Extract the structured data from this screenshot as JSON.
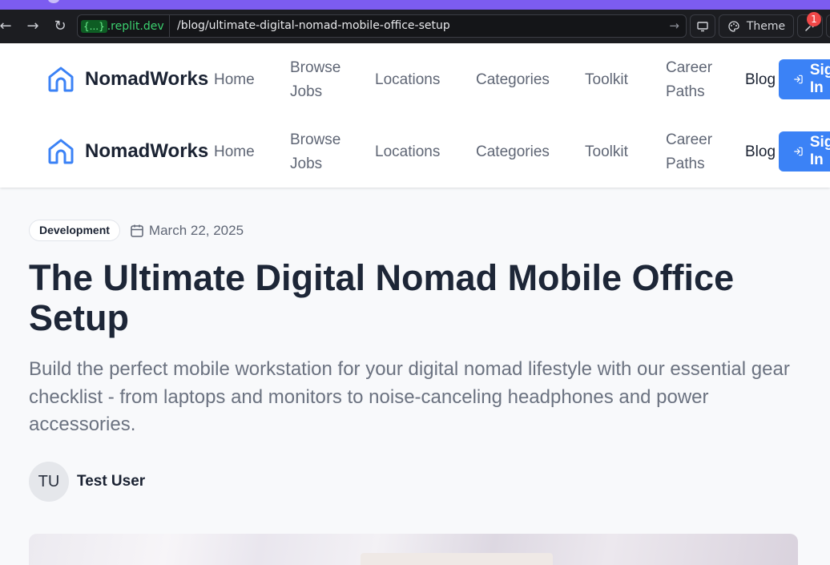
{
  "browser": {
    "host_brace": "{...}",
    "host": ".replit.dev",
    "path": "/blog/ultimate-digital-nomad-mobile-office-setup",
    "theme_label": "Theme",
    "notification_count": "1",
    "icons": [
      "back-arrow-icon",
      "forward-arrow-icon",
      "reload-icon",
      "go-arrow-icon",
      "monitor-icon",
      "palette-icon",
      "wrench-icon"
    ]
  },
  "site": {
    "brand": "NomadWorks",
    "nav": {
      "home": "Home",
      "browse_jobs_1": "Browse",
      "browse_jobs_2": "Jobs",
      "locations": "Locations",
      "categories": "Categories",
      "toolkit": "Toolkit",
      "career_paths_1": "Career",
      "career_paths_2": "Paths",
      "blog": "Blog"
    },
    "signin_label": "Sign In",
    "accent_color": "#3b82f6"
  },
  "article": {
    "category": "Development",
    "date": "March 22, 2025",
    "title": "The Ultimate Digital Nomad Mobile Office Setup",
    "subtitle": "Build the perfect mobile workstation for your digital nomad lifestyle with our essential gear checklist - from laptops and monitors to noise-canceling headphones and power accessories.",
    "author_initials": "TU",
    "author_name": "Test User"
  }
}
